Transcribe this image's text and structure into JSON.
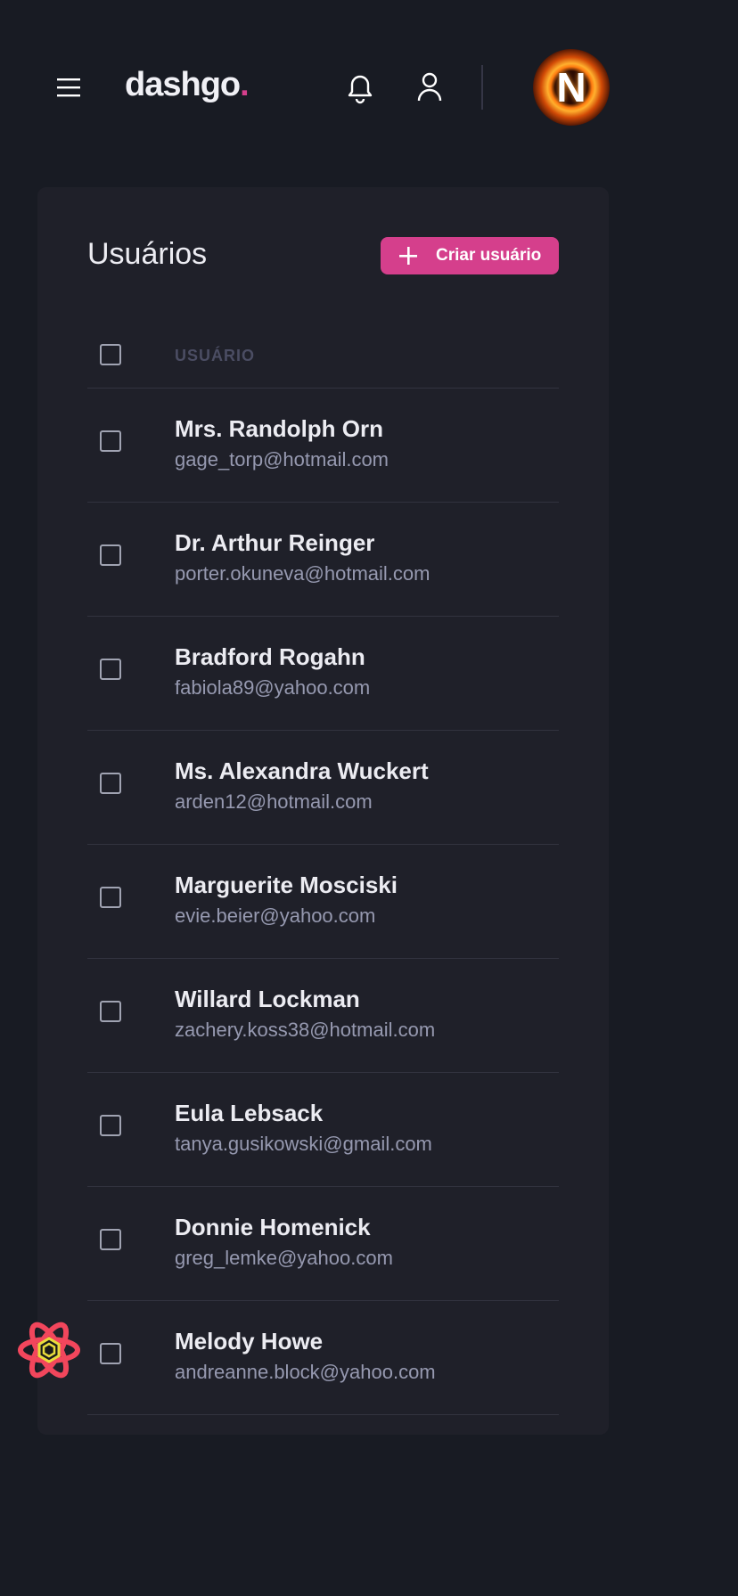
{
  "header": {
    "logo_text": "dashgo",
    "logo_dot": ".",
    "avatar_letter": "N",
    "icons": {
      "menu": "hamburger-menu-icon",
      "notifications": "bell-icon",
      "profile": "user-icon"
    }
  },
  "colors": {
    "background": "#181b23",
    "card": "#1f2029",
    "accent": "#d53f8c",
    "muted_text": "#9699b0",
    "header_label": "#4b4d63"
  },
  "page": {
    "title": "Usuários",
    "create_button_label": "Criar usuário"
  },
  "table": {
    "column_header": "USUÁRIO",
    "rows": [
      {
        "name": "Mrs. Randolph Orn",
        "email": "gage_torp@hotmail.com"
      },
      {
        "name": "Dr. Arthur Reinger",
        "email": "porter.okuneva@hotmail.com"
      },
      {
        "name": "Bradford Rogahn",
        "email": "fabiola89@yahoo.com"
      },
      {
        "name": "Ms. Alexandra Wuckert",
        "email": "arden12@hotmail.com"
      },
      {
        "name": "Marguerite Mosciski",
        "email": "evie.beier@yahoo.com"
      },
      {
        "name": "Willard Lockman",
        "email": "zachery.koss38@hotmail.com"
      },
      {
        "name": "Eula Lebsack",
        "email": "tanya.gusikowski@gmail.com"
      },
      {
        "name": "Donnie Homenick",
        "email": "greg_lemke@yahoo.com"
      },
      {
        "name": "Melody Howe",
        "email": "andreanne.block@yahoo.com"
      }
    ]
  }
}
